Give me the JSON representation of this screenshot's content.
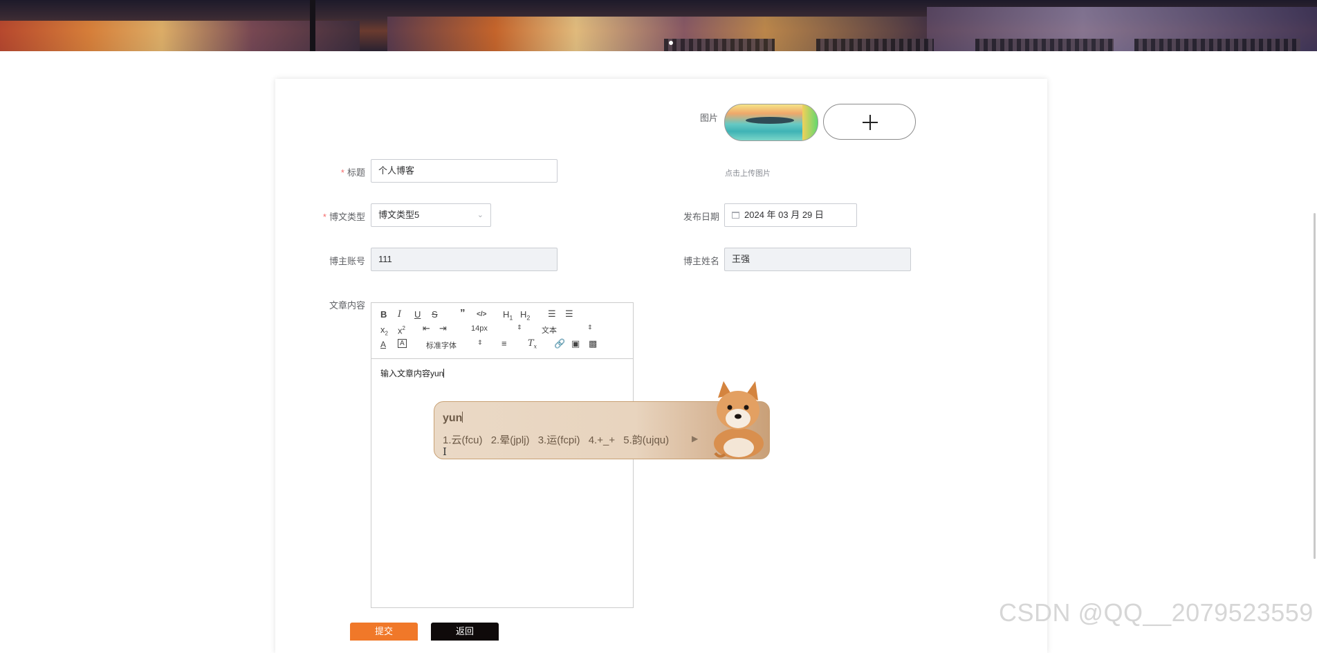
{
  "form": {
    "image_label": "图片",
    "upload_tip": "点击上传图片",
    "title_label": "标题",
    "title_value": "个人博客",
    "type_label": "博文类型",
    "type_value": "博文类型5",
    "date_label": "发布日期",
    "date_value": "2024 年 03 月 29 日",
    "account_label": "博主账号",
    "account_value": "111",
    "name_label": "博主姓名",
    "name_value": "王强",
    "content_label": "文章内容",
    "required_mark": "*"
  },
  "editor": {
    "font_size": "14px",
    "block_format": "文本",
    "font_family": "标准字体",
    "content": "输入文章内容yun",
    "icons": [
      "bold-icon",
      "italic-icon",
      "underline-icon",
      "strike-icon",
      "quote-icon",
      "code-icon",
      "h1-icon",
      "h2-icon",
      "ordered-list-icon",
      "bullet-list-icon",
      "subscript-icon",
      "superscript-icon",
      "outdent-icon",
      "indent-icon",
      "font-color-icon",
      "background-color-icon",
      "align-icon",
      "clear-format-icon",
      "link-icon",
      "image-icon",
      "video-icon"
    ]
  },
  "ime": {
    "composition": "yun",
    "candidates": [
      "1.云(fcu)",
      "2.晕(jplj)",
      "3.运(fcpi)",
      "4.+_+",
      "5.韵(ujqu)"
    ]
  },
  "actions": {
    "submit_label": "提交",
    "back_label": "返回"
  },
  "watermark": "CSDN @QQ__2079523559",
  "colors": {
    "submit": "#f07829",
    "back": "#0f0a0a",
    "required": "#f56c6c"
  }
}
